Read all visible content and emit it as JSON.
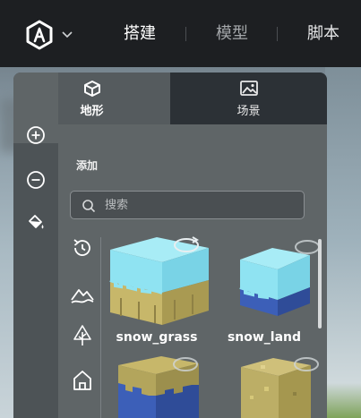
{
  "topbar": {
    "logo": "cube-logo-icon",
    "nav": [
      {
        "label": "搭建",
        "active": true
      },
      {
        "label": "模型",
        "active": false
      },
      {
        "label": "脚本",
        "active": false
      }
    ]
  },
  "panel": {
    "tabs": [
      {
        "label": "地形",
        "icon": "cube-icon",
        "active": true
      },
      {
        "label": "场景",
        "icon": "image-icon",
        "active": false
      }
    ],
    "sidebar": [
      "add-circle-icon",
      "remove-circle-icon",
      "paint-bucket-icon"
    ],
    "add_label": "添加",
    "search": {
      "placeholder": "搜索",
      "value": ""
    },
    "categories": [
      "recent-icon",
      "mountains-icon",
      "tree-icon",
      "house-icon"
    ],
    "blocks": [
      {
        "name": "snow_grass"
      },
      {
        "name": "snow_land"
      },
      {
        "name": ""
      },
      {
        "name": ""
      }
    ]
  },
  "colors": {
    "topbar": "#1d1f22",
    "panel": "#5f6567",
    "tab_inactive": "#2c3136",
    "snow": "#8fe3f2",
    "dirt": "#c7b76a",
    "water_blue": "#3c5fb8"
  }
}
